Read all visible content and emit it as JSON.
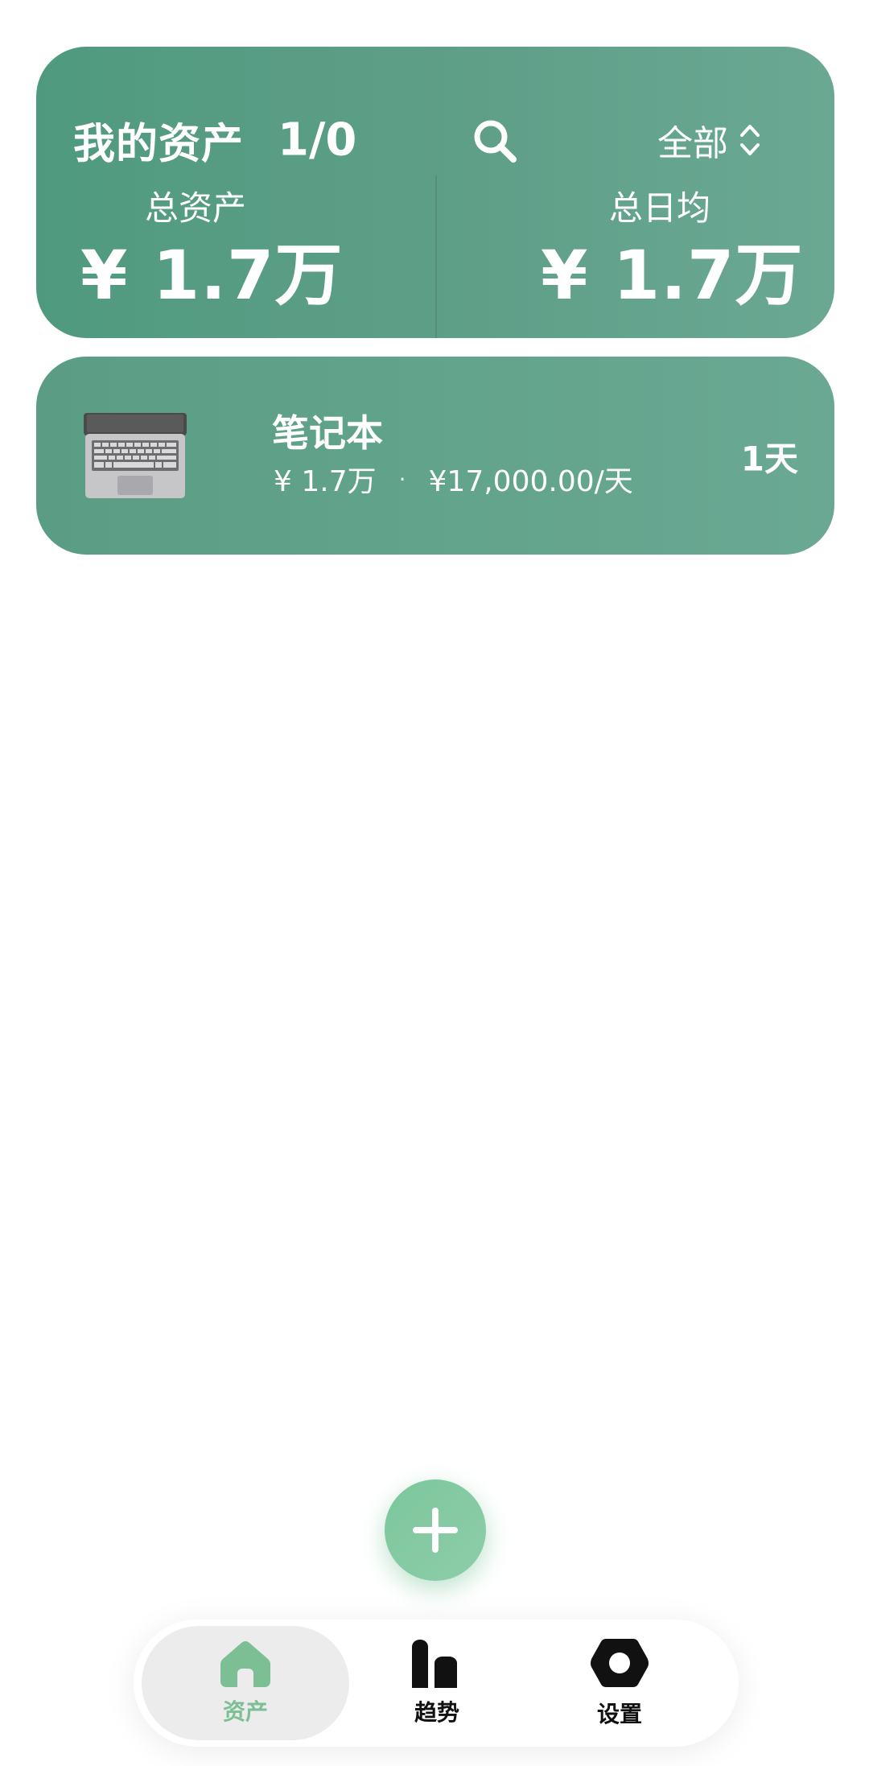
{
  "summary": {
    "title": "我的资产",
    "count": "1/0",
    "filter_label": "全部",
    "total_assets_label": "总资产",
    "total_assets_value": "¥ 1.7万",
    "daily_avg_label": "总日均",
    "daily_avg_value": "¥ 1.7万"
  },
  "assets": [
    {
      "name": "笔记本",
      "price": "¥ 1.7万",
      "separator": "·",
      "per_day": "¥17,000.00/天",
      "days": "1天",
      "icon": "laptop-icon"
    }
  ],
  "nav": {
    "items": [
      {
        "label": "资产",
        "icon": "home-icon",
        "active": true
      },
      {
        "label": "趋势",
        "icon": "bar-chart-icon",
        "active": false
      },
      {
        "label": "设置",
        "icon": "gear-icon",
        "active": false
      }
    ]
  },
  "colors": {
    "card_green": "#5f9f88",
    "accent_green": "#7cbf95",
    "fab_green": "#84ca9f"
  }
}
